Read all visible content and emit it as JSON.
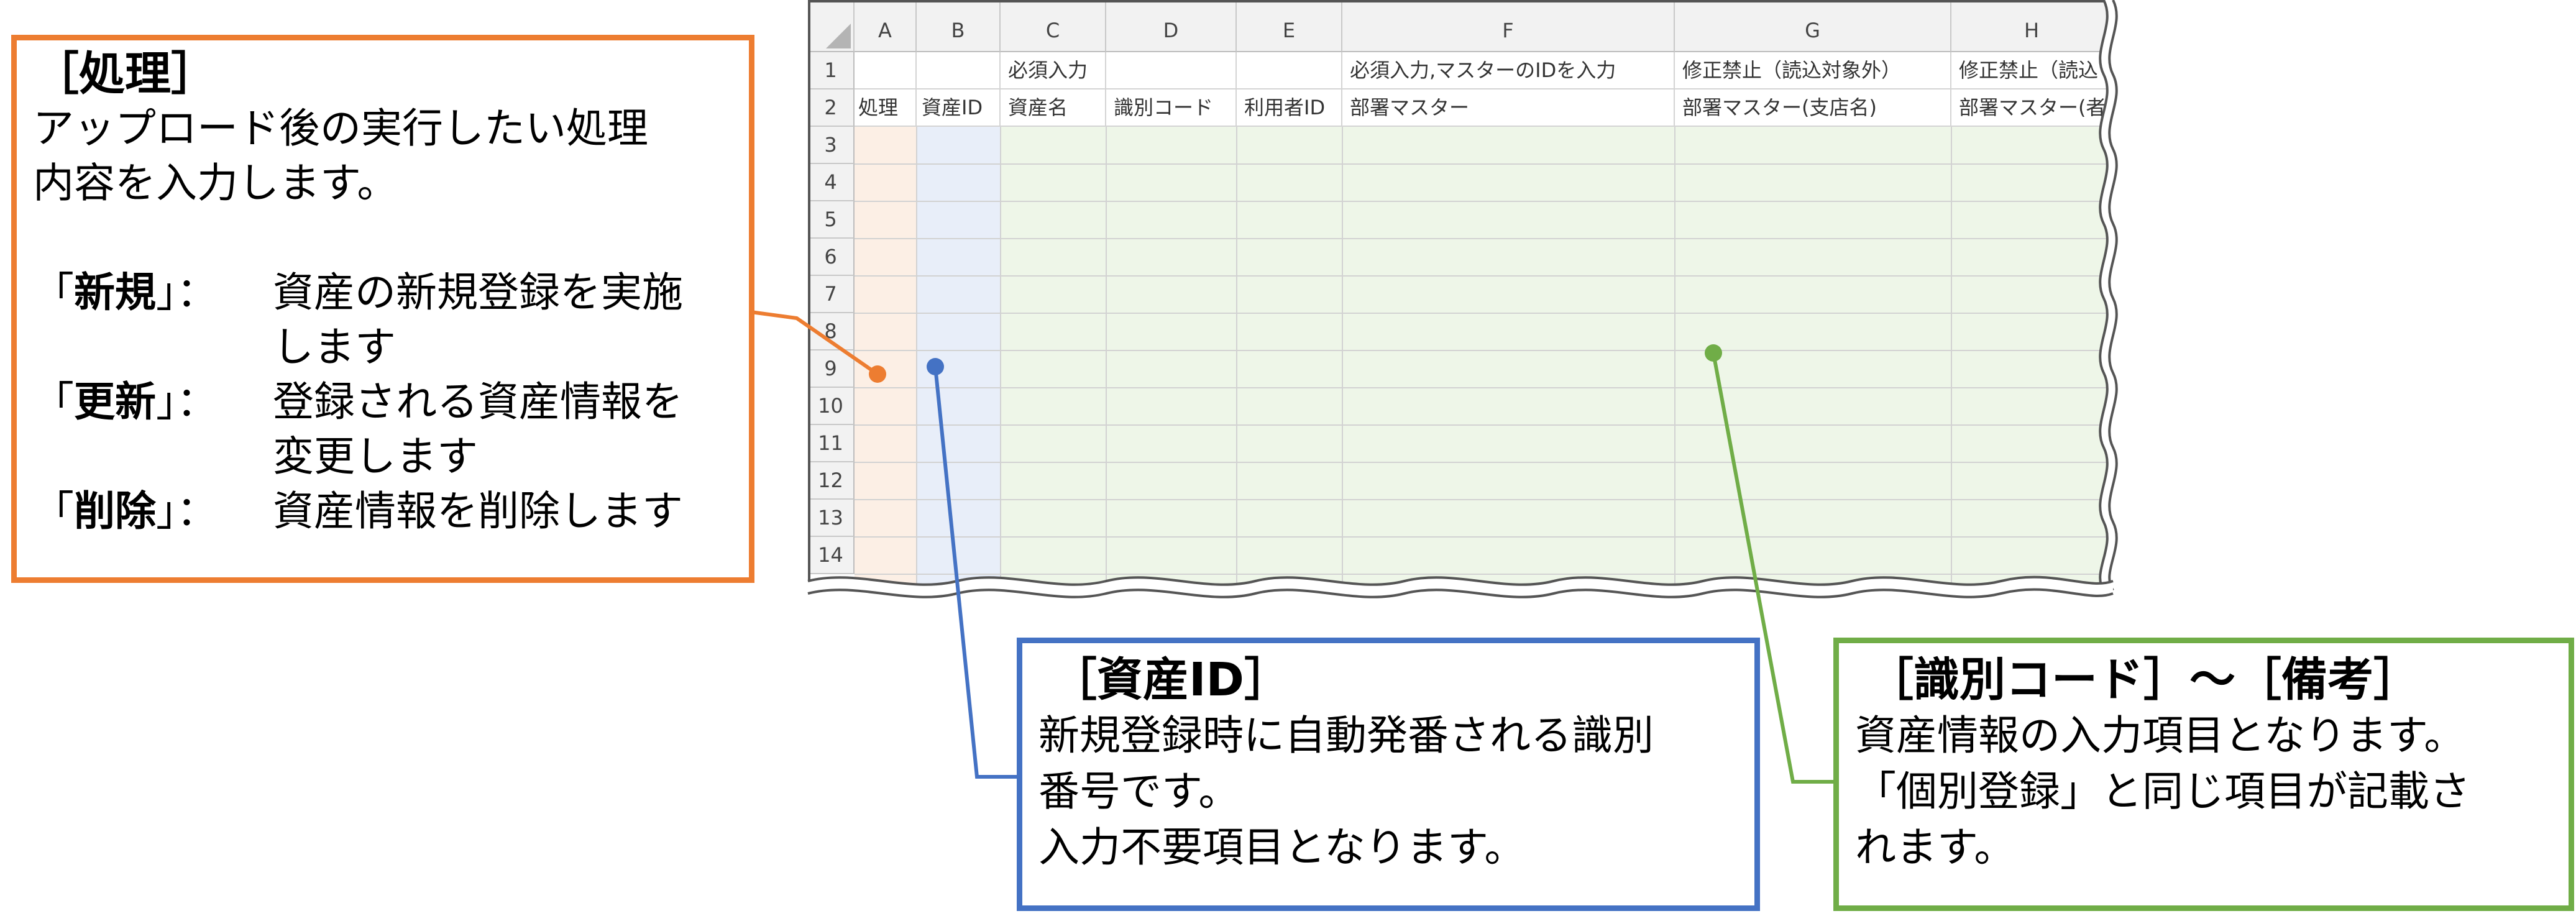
{
  "sheet": {
    "columns": [
      "A",
      "B",
      "C",
      "D",
      "E",
      "F",
      "G",
      "H"
    ],
    "rows": [
      "1",
      "2",
      "3",
      "4",
      "5",
      "6",
      "7",
      "8",
      "9",
      "10",
      "11",
      "12",
      "13",
      "14"
    ],
    "row1": {
      "C": "必須入力",
      "F": "必須入力,マスターのIDを入力",
      "G": "修正禁止（読込対象外）",
      "H": "修正禁止（読込"
    },
    "row2": {
      "A": "処理",
      "B": "資産ID",
      "C": "資産名",
      "D": "識別コード",
      "E": "利用者ID",
      "F": "部署マスター",
      "G": "部署マスター(支店名)",
      "H": "部署マスター(者"
    }
  },
  "colors": {
    "orange": "#ed7d31",
    "blue": "#4472c4",
    "green": "#70ad47"
  },
  "callouts": {
    "process": {
      "title": "［処理］",
      "desc_line1": "アップロード後の実行したい処理",
      "desc_line2": "内容を入力します。",
      "items": [
        {
          "open": "「",
          "keyword": "新規",
          "close": "」：",
          "text1": "資産の新規登録を実施",
          "text2": "します"
        },
        {
          "open": "「",
          "keyword": "更新",
          "close": "」：",
          "text1": "登録される資産情報を",
          "text2": "変更します"
        },
        {
          "open": "「",
          "keyword": "削除",
          "close": "」：",
          "text1": "資産情報を削除します",
          "text2": ""
        }
      ]
    },
    "asset_id": {
      "title": "［資産ID］",
      "line1": "新規登録時に自動発番される識別",
      "line2": "番号です。",
      "line3": "入力不要項目となります。"
    },
    "fields": {
      "title": "［識別コード］～［備考］",
      "line1": "資産情報の入力項目となります。",
      "line2": "「個別登録」と同じ項目が記載さ",
      "line3": "れます。"
    }
  }
}
